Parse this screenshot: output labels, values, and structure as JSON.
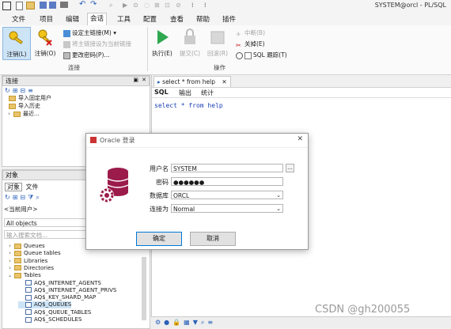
{
  "window": {
    "title": "SYSTEM@orcl - PL/SQL"
  },
  "menu": [
    "文件",
    "项目",
    "编辑",
    "会话",
    "工具",
    "配置",
    "查看",
    "帮助",
    "插件"
  ],
  "ribbon": {
    "logoff1": "注销(L)",
    "logoff2": "注销(O)",
    "set_main": "设定主链接(M)",
    "set_current": "将主链接设为当前链接",
    "change_pw": "更改密码(P)...",
    "execute": "执行(E)",
    "commit": "提交(C)",
    "rollback": "回滚(R)",
    "break": "中断(B)",
    "close": "关掉(E)",
    "sql_trace": "SQL 跟踪(T)",
    "group_connect": "连接",
    "group_ops": "操作"
  },
  "connections": {
    "header": "连接",
    "items": [
      "导入固定用户",
      "导入历史",
      "最近..."
    ]
  },
  "editor": {
    "tab": "select * from help",
    "subtabs": [
      "SQL",
      "输出",
      "统计"
    ],
    "sql": "select * from help"
  },
  "objects": {
    "header": "对象",
    "tabs": [
      "对象",
      "文件"
    ],
    "user": "<当前用户>",
    "filter": "All objects",
    "search_placeholder": "输入搜索文档...",
    "tree": [
      {
        "label": "Queues",
        "type": "folder",
        "level": 0
      },
      {
        "label": "Queue tables",
        "type": "folder",
        "level": 0
      },
      {
        "label": "Libraries",
        "type": "folder",
        "level": 0
      },
      {
        "label": "Directories",
        "type": "folder",
        "level": 0
      },
      {
        "label": "Tables",
        "type": "folder",
        "level": 0,
        "expanded": true
      },
      {
        "label": "AQ$_INTERNET_AGENTS",
        "type": "table",
        "level": 1
      },
      {
        "label": "AQ$_INTERNET_AGENT_PRIVS",
        "type": "table",
        "level": 1
      },
      {
        "label": "AQ$_KEY_SHARD_MAP",
        "type": "table",
        "level": 1
      },
      {
        "label": "AQ$_QUEUES",
        "type": "table",
        "level": 1,
        "selected": true
      },
      {
        "label": "AQ$_QUEUE_TABLES",
        "type": "table",
        "level": 1
      },
      {
        "label": "AQ$_SCHEDULES",
        "type": "table",
        "level": 1
      }
    ]
  },
  "dialog": {
    "title": "Oracle 登录",
    "username_label": "用户名",
    "username": "SYSTEM",
    "password_label": "密码",
    "password": "●●●●●●",
    "database_label": "数据库",
    "database": "ORCL",
    "connect_as_label": "连接为",
    "connect_as": "Normal",
    "ok": "确定",
    "cancel": "取消",
    "browse": "..."
  },
  "watermark": "CSDN @gh200055"
}
